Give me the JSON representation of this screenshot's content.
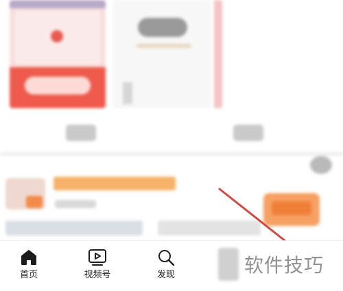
{
  "tabbar": {
    "tabs": [
      {
        "label": "首页",
        "icon": "home-icon"
      },
      {
        "label": "视频号",
        "icon": "video-channel-icon"
      },
      {
        "label": "发现",
        "icon": "search-icon"
      }
    ]
  },
  "watermark": {
    "text": "软件技巧"
  },
  "colors": {
    "promo_red": "#ee5a4c",
    "accent_orange": "#f6a064",
    "arrow": "#d04a44",
    "tab_text": "#222222"
  }
}
